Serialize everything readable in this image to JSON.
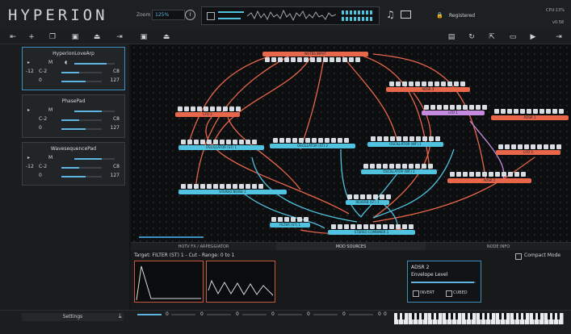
{
  "app": {
    "logo": "HYPERION",
    "zoom_label": "Zoom",
    "zoom_value": "125%",
    "registered_label": "Registered",
    "cpu_text": "CPU:13%",
    "version": "v0.58"
  },
  "patches": [
    {
      "name": "HyperionLoveArp",
      "selected": true,
      "note_low": "C-2",
      "note_high": "C8",
      "vel_low": "0",
      "vel_high": "127",
      "side_value": "-12"
    },
    {
      "name": "PhasePad",
      "selected": false,
      "note_low": "C-2",
      "note_high": "C8",
      "vel_low": "0",
      "vel_high": "127",
      "side_value": "-12"
    },
    {
      "name": "WavesequencePad",
      "selected": false,
      "note_low": "C-2",
      "note_high": "C8",
      "vel_low": "0",
      "vel_high": "127",
      "side_value": "-12"
    }
  ],
  "nodes": {
    "n1": "NOTES INPUT",
    "n2": "ADSR 3",
    "n3": "LFO 2",
    "n4": "LFO 1",
    "n5": "ADSR 1",
    "n6": "OSCILLATOR (ST) 1",
    "n7": "OSCILLATOR (ST) 2",
    "n8": "OSCILLATOR (WF) 1",
    "n9": "LFO 3",
    "n10": "OSCILLATOR (WF) 2",
    "n11": "STEREO NOISE 1",
    "n12": "ADSR 2",
    "n13": "REVERB (ST) 1",
    "n14": "FILTER (ST) 1",
    "n15": "STEREO COMBINER 1"
  },
  "tabs": {
    "hotfx": "HOTV FX / ARPEGGIATOR",
    "modsources": "MOD SOURCES",
    "nodeinfo": "NODE INFO"
  },
  "mod": {
    "target": "Target: FILTER (ST) 1 - Cut - Range: 0 to 1",
    "compact_label": "Compact Mode",
    "adsr_title": "ADSR 2",
    "adsr_param": "Envelope Level",
    "invert_label": "INVERT",
    "cubed_label": "CUBED"
  },
  "footer": {
    "settings_label": "Settings",
    "slider_values": [
      "0",
      "0",
      "0",
      "0",
      "0",
      "0",
      "0",
      "0"
    ]
  }
}
